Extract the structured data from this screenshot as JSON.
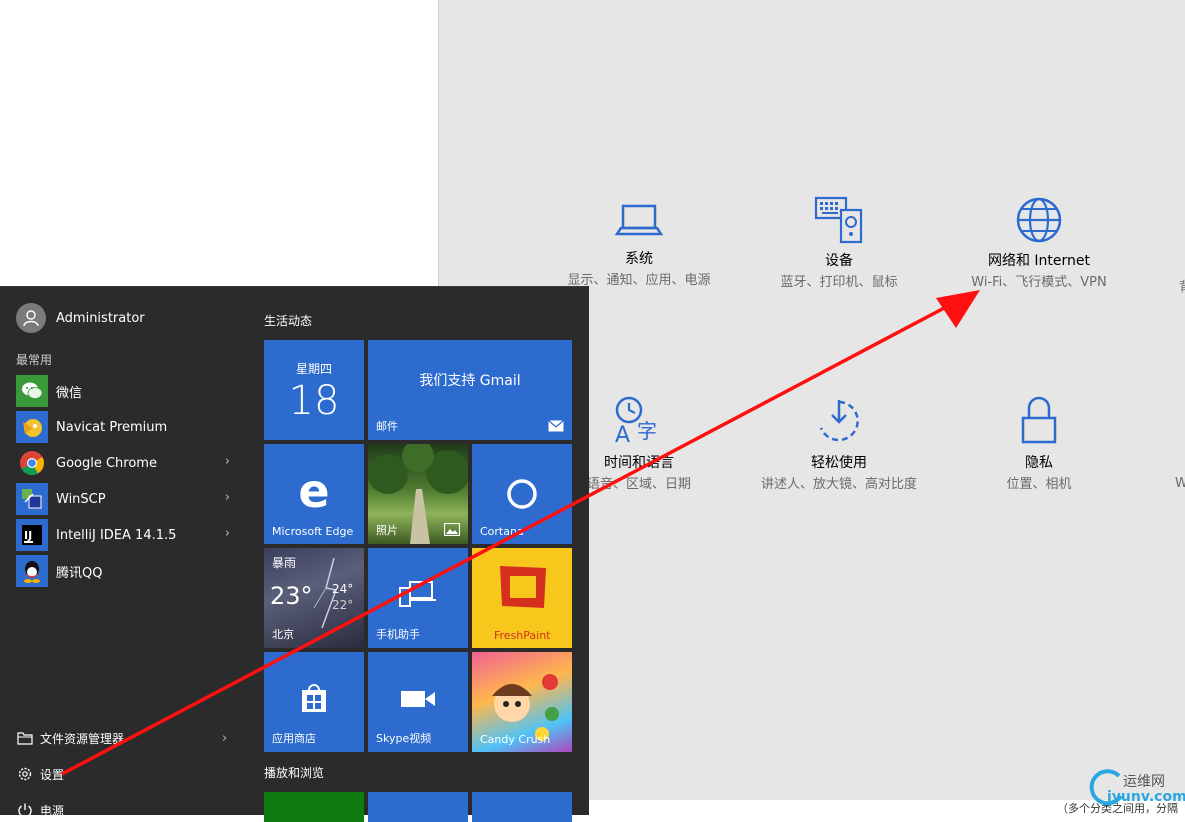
{
  "settings": {
    "items": [
      {
        "title": "系统",
        "desc": "显示、通知、应用、电源"
      },
      {
        "title": "设备",
        "desc": "蓝牙、打印机、鼠标"
      },
      {
        "title": "网络和 Internet",
        "desc": "Wi-Fi、飞行模式、VPN"
      },
      {
        "title": "时间和语言",
        "desc": "语音、区域、日期"
      },
      {
        "title": "轻松使用",
        "desc": "讲述人、放大镜、高对比度"
      },
      {
        "title": "隐私",
        "desc": "位置、相机"
      }
    ],
    "edge_text": [
      "背",
      "W"
    ]
  },
  "start_menu": {
    "user_name": "Administrator",
    "most_used_label": "最常用",
    "apps": [
      {
        "label": "微信",
        "has_submenu": false,
        "icon": "wechat-icon"
      },
      {
        "label": "Navicat Premium",
        "has_submenu": false,
        "icon": "navicat-icon"
      },
      {
        "label": "Google Chrome",
        "has_submenu": true,
        "icon": "chrome-icon"
      },
      {
        "label": "WinSCP",
        "has_submenu": true,
        "icon": "winscp-icon"
      },
      {
        "label": "IntelliJ IDEA 14.1.5",
        "has_submenu": true,
        "icon": "intellij-icon"
      },
      {
        "label": "腾讯QQ",
        "has_submenu": false,
        "icon": "qq-icon"
      }
    ],
    "bottom": {
      "file_explorer": "文件资源管理器",
      "settings": "设置",
      "power": "电源"
    },
    "chevron": "›",
    "live_section": "生活动态",
    "play_section": "播放和浏览",
    "tiles": {
      "calendar": {
        "weekday": "星期四",
        "day": "18"
      },
      "mail": {
        "headline": "我们支持 Gmail",
        "name": "邮件"
      },
      "edge": {
        "name": "Microsoft Edge"
      },
      "photos": {
        "name": "照片"
      },
      "cortana": {
        "name": "Cortana"
      },
      "weather": {
        "condition": "暴雨",
        "temp": "23°",
        "high": "24°",
        "low": "22°",
        "city": "北京"
      },
      "phone": {
        "name": "手机助手"
      },
      "freshpaint": {
        "name": "FreshPaint"
      },
      "store": {
        "name": "应用商店"
      },
      "skype": {
        "name": "Skype视频"
      },
      "candy": {
        "name": "Candy Crush"
      }
    }
  },
  "watermark": {
    "brand": "运维网",
    "domain": "iyunv.com"
  },
  "clip_text": "（多个分类之间用，分隔"
}
